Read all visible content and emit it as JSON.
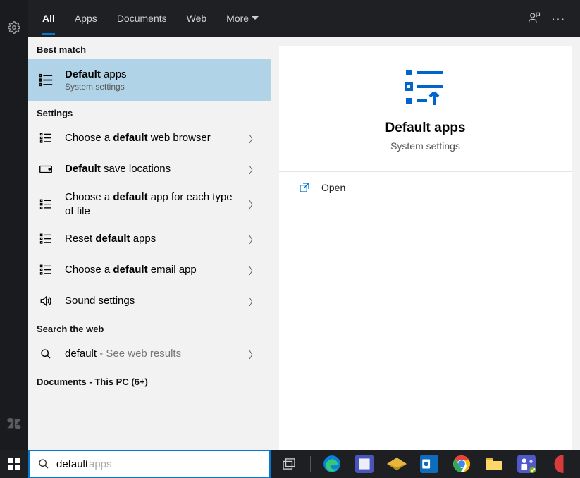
{
  "tabs": {
    "all": "All",
    "apps": "Apps",
    "documents": "Documents",
    "web": "Web",
    "more": "More"
  },
  "sections": {
    "best_match": "Best match",
    "settings": "Settings",
    "search_web": "Search the web",
    "documents": "Documents - This PC (6+)"
  },
  "best": {
    "title_pre": "Default",
    "title_post": " apps",
    "subtitle": "System settings"
  },
  "settings_items": {
    "s1_pre": "Choose a ",
    "s1_bold": "default",
    "s1_post": " web browser",
    "s2_pre": "Default",
    "s2_post": " save locations",
    "s3_pre": "Choose a ",
    "s3_bold": "default",
    "s3_post": " app for each type of file",
    "s4_pre": "Reset ",
    "s4_bold": "default",
    "s4_post": " apps",
    "s5_pre": "Choose a ",
    "s5_bold": "default",
    "s5_post": " email app",
    "s6": "Sound settings"
  },
  "web": {
    "prefix": "default",
    "suffix": " - See web results"
  },
  "preview": {
    "title": "Default apps",
    "subtitle": "System settings",
    "open": "Open"
  },
  "search": {
    "value": "default",
    "ghost": " apps"
  }
}
